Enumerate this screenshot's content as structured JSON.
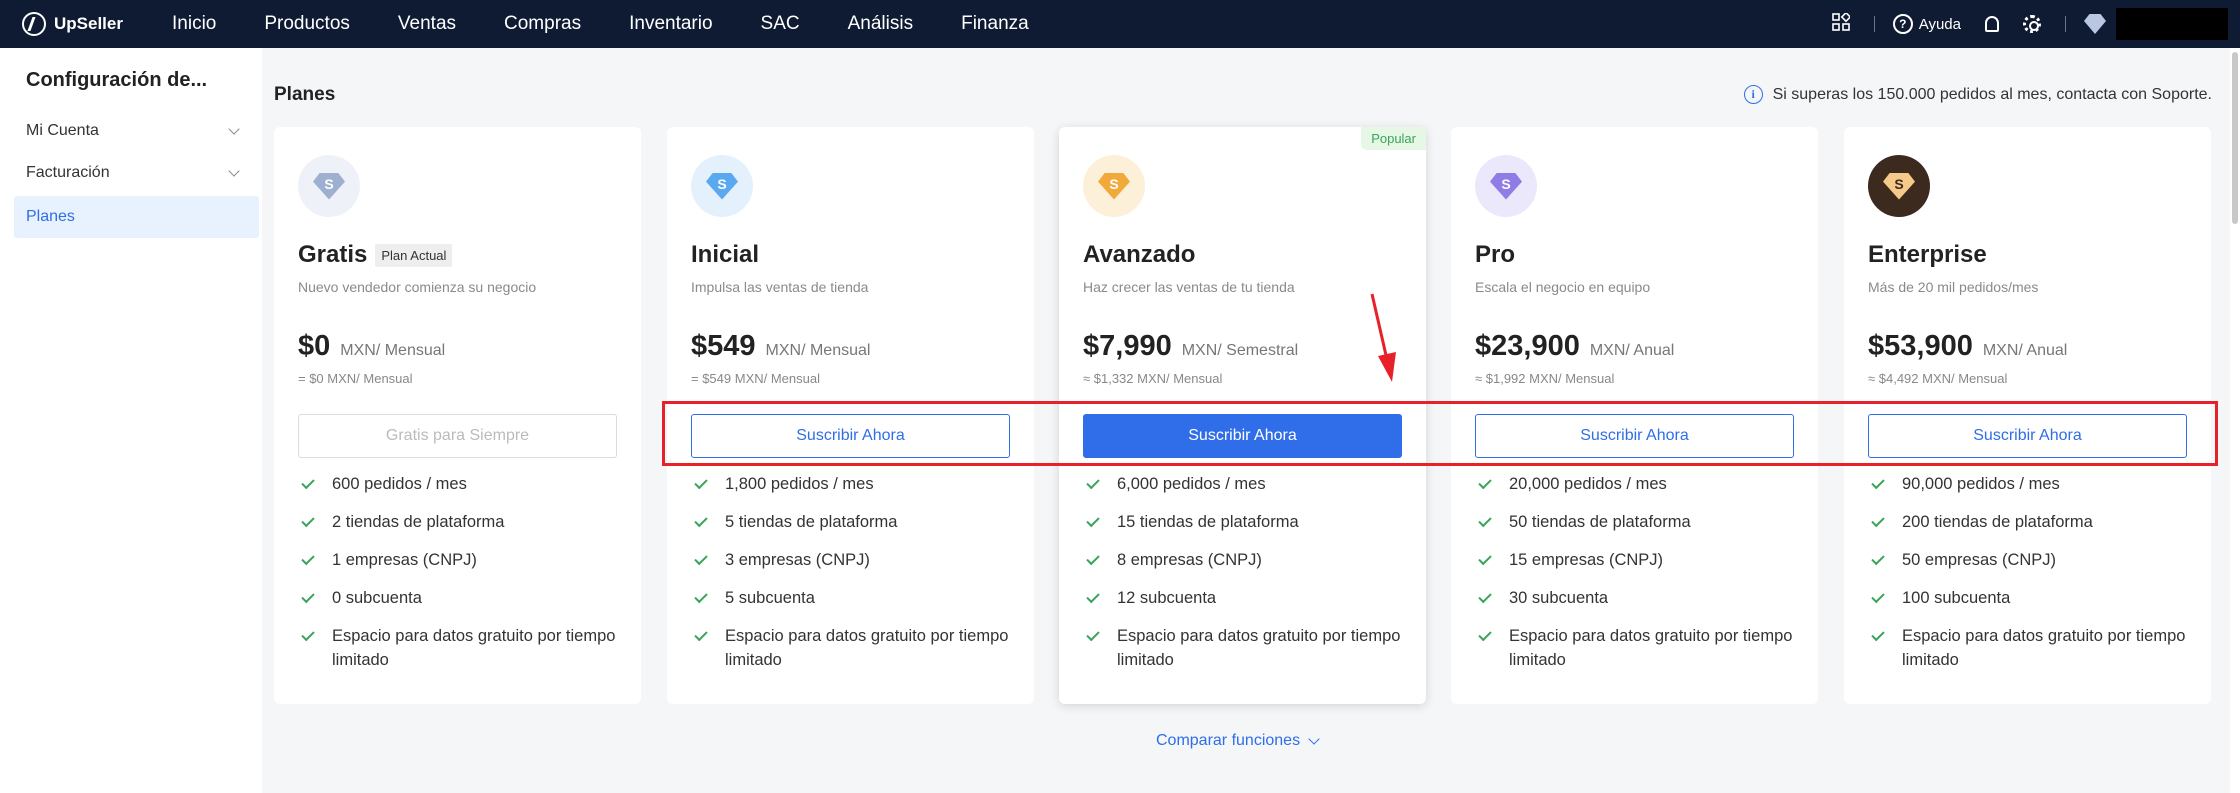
{
  "app": {
    "name": "UpSeller"
  },
  "nav": {
    "items": [
      "Inicio",
      "Productos",
      "Ventas",
      "Compras",
      "Inventario",
      "SAC",
      "Análisis",
      "Finanza"
    ]
  },
  "header_right": {
    "help_label": "Ayuda"
  },
  "sidebar": {
    "title": "Configuración de...",
    "items": [
      {
        "label": "Mi Cuenta",
        "expandable": true
      },
      {
        "label": "Facturación",
        "expandable": true
      },
      {
        "label": "Planes",
        "active": true
      }
    ]
  },
  "main": {
    "title": "Planes",
    "notice": "Si superas los 150.000 pedidos al mes, contacta con Soporte.",
    "compare_label": "Comparar funciones",
    "plans": [
      {
        "name": "Gratis",
        "badge": "Plan Actual",
        "description": "Nuevo vendedor comienza su negocio",
        "price": "$0",
        "unit": "MXN/ Mensual",
        "sub": "= $0 MXN/ Mensual",
        "button": "Gratis para Siempre",
        "button_style": "disabled",
        "icon_color": "#9db0cf",
        "features": [
          "600 pedidos / mes",
          "2 tiendas de plataforma",
          "1 empresas (CNPJ)",
          "0 subcuenta",
          "Espacio para datos gratuito por tiempo limitado"
        ]
      },
      {
        "name": "Inicial",
        "description": "Impulsa las ventas de tienda",
        "price": "$549",
        "unit": "MXN/ Mensual",
        "sub": "= $549 MXN/ Mensual",
        "button": "Suscribir Ahora",
        "button_style": "outline",
        "icon_color": "#5aa8f0",
        "features": [
          "1,800 pedidos / mes",
          "5 tiendas de plataforma",
          "3 empresas (CNPJ)",
          "5 subcuenta",
          "Espacio para datos gratuito por tiempo limitado"
        ]
      },
      {
        "name": "Avanzado",
        "popular": "Popular",
        "description": "Haz crecer las ventas de tu tienda",
        "price": "$7,990",
        "unit": "MXN/ Semestral",
        "sub": "≈ $1,332 MXN/ Mensual",
        "button": "Suscribir Ahora",
        "button_style": "primary",
        "icon_color": "#f2a93b",
        "features": [
          "6,000 pedidos / mes",
          "15 tiendas de plataforma",
          "8 empresas (CNPJ)",
          "12 subcuenta",
          "Espacio para datos gratuito por tiempo limitado"
        ]
      },
      {
        "name": "Pro",
        "description": "Escala el negocio en equipo",
        "price": "$23,900",
        "unit": "MXN/ Anual",
        "sub": "≈ $1,992 MXN/ Mensual",
        "button": "Suscribir Ahora",
        "button_style": "outline",
        "icon_color": "#8f7ce6",
        "features": [
          "20,000 pedidos / mes",
          "50 tiendas de plataforma",
          "15 empresas (CNPJ)",
          "30 subcuenta",
          "Espacio para datos gratuito por tiempo limitado"
        ]
      },
      {
        "name": "Enterprise",
        "description": "Más de 20 mil pedidos/mes",
        "price": "$53,900",
        "unit": "MXN/ Anual",
        "sub": "≈ $4,492 MXN/ Mensual",
        "button": "Suscribir Ahora",
        "button_style": "outline",
        "icon_color": "#f5c98a",
        "features": [
          "90,000 pedidos / mes",
          "200 tiendas de plataforma",
          "50 empresas (CNPJ)",
          "100 subcuenta",
          "Espacio para datos gratuito por tiempo limitado"
        ]
      }
    ]
  },
  "colors": {
    "accent": "#2f6ee8",
    "nav_bg": "#0f1b33",
    "check": "#3aa45a",
    "annotation": "#e8202a"
  }
}
